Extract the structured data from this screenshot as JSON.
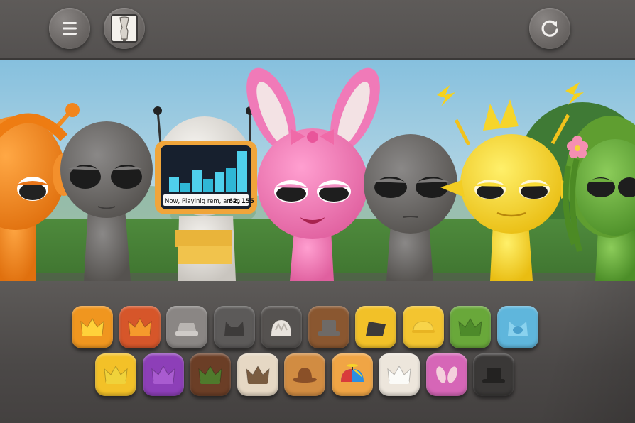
{
  "toolbar": {
    "menu_icon": "hamburger-menu-icon",
    "wardrobe_icon": "mannequin-icon",
    "reset_icon": "refresh-icon"
  },
  "now_playing": {
    "text": "Now, Playinig rem, aman.",
    "numbers": "62, 155",
    "equalizer_levels": [
      0.35,
      0.2,
      0.5,
      0.3,
      0.45,
      0.55,
      0.95
    ]
  },
  "characters": [
    {
      "name": "orange-headphones-character",
      "color": "#f28a1e"
    },
    {
      "name": "gray-character-left",
      "color": "#6d6b6a"
    },
    {
      "name": "tv-head-character",
      "color": "#e0ddd8"
    },
    {
      "name": "pink-bunny-character",
      "color": "#f07ab8"
    },
    {
      "name": "gray-character-right",
      "color": "#6d6b6a"
    },
    {
      "name": "yellow-sun-character",
      "color": "#f6d52a"
    },
    {
      "name": "green-leafy-character",
      "color": "#6cab3c"
    }
  ],
  "hat_tiles": {
    "row1": [
      {
        "name": "orange-crown-tile",
        "bg": "#f0961f",
        "icon": "crown-icon",
        "fg": "#ffd23a"
      },
      {
        "name": "red-crown-tile",
        "bg": "#d6562a",
        "icon": "crown-icon",
        "fg": "#f59a2c"
      },
      {
        "name": "gray-paper-hat-tile",
        "bg": "#8a8684",
        "icon": "paper-hat-icon",
        "fg": "#b9b5b2"
      },
      {
        "name": "dark-gray-hat-tile",
        "bg": "#5c5a59",
        "icon": "cat-ear-hat-icon",
        "fg": "#3d3b3a"
      },
      {
        "name": "white-ear-hat-tile",
        "bg": "#555250",
        "icon": "beanie-icon",
        "fg": "#e8e3dd"
      },
      {
        "name": "brown-top-hat-tile",
        "bg": "#8a5730",
        "icon": "top-hat-icon",
        "fg": "#6e6a67"
      },
      {
        "name": "yellow-flag-tile",
        "bg": "#f2c128",
        "icon": "flag-hat-icon",
        "fg": "#3c3a39"
      },
      {
        "name": "yellow-cap-tile",
        "bg": "#f3c530",
        "icon": "cap-icon",
        "fg": "#f8d44a"
      },
      {
        "name": "green-crown-tile",
        "bg": "#69a83a",
        "icon": "crown-icon",
        "fg": "#4d8a2a"
      },
      {
        "name": "blue-cat-hat-tile",
        "bg": "#5fb6dc",
        "icon": "cat-face-hat-icon",
        "fg": "#8ad2ee"
      }
    ],
    "row2": [
      {
        "name": "yellow-crown-tile",
        "bg": "#f3c128",
        "icon": "crown-icon",
        "fg": "#f0d23a"
      },
      {
        "name": "purple-crown-tile",
        "bg": "#8d3fb8",
        "icon": "crown-icon",
        "fg": "#a95bd0"
      },
      {
        "name": "brown-leaf-crown-tile",
        "bg": "#6b3e26",
        "icon": "crown-icon",
        "fg": "#4f7a2c"
      },
      {
        "name": "cream-crown-tile",
        "bg": "#e6d8c4",
        "icon": "crown-icon",
        "fg": "#7a5c40"
      },
      {
        "name": "bowler-hat-tile",
        "bg": "#d18c42",
        "icon": "bowler-hat-icon",
        "fg": "#8a5028"
      },
      {
        "name": "propeller-cap-tile",
        "bg": "#f0a545",
        "icon": "propeller-cap-icon",
        "fg": "#d93b3b"
      },
      {
        "name": "white-crown-tile",
        "bg": "#ede6dc",
        "icon": "crown-icon",
        "fg": "#fbfbf8"
      },
      {
        "name": "pink-bunny-ears-tile",
        "bg": "#d666b7",
        "icon": "bunny-ears-icon",
        "fg": "#f4d0dc"
      },
      {
        "name": "black-top-hat-tile",
        "bg": "#3a3837",
        "icon": "top-hat-icon",
        "fg": "#232221"
      }
    ]
  }
}
